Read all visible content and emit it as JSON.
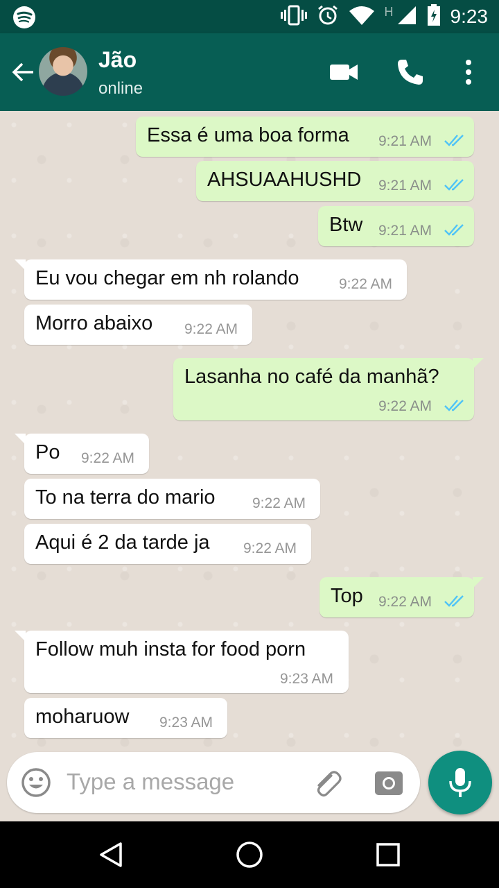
{
  "status_bar": {
    "time": "9:23",
    "network_label": "H",
    "icons": [
      "spotify-icon",
      "vibrate-icon",
      "alarm-icon",
      "wifi-icon",
      "signal-icon",
      "battery-icon"
    ]
  },
  "header": {
    "contact_name": "Jão",
    "contact_status": "online",
    "icons": [
      "back-arrow-icon",
      "avatar",
      "video-call-icon",
      "phone-call-icon",
      "more-vert-icon"
    ]
  },
  "messages": [
    {
      "dir": "out",
      "text": "Essa é uma boa forma",
      "time": "9:21 AM",
      "read": true
    },
    {
      "dir": "out",
      "text": "AHSUAAHUSHD",
      "time": "9:21 AM",
      "read": true
    },
    {
      "dir": "out",
      "text": "Btw",
      "time": "9:21 AM",
      "read": true
    },
    {
      "dir": "in",
      "text": "Eu vou chegar em nh rolando",
      "time": "9:22 AM"
    },
    {
      "dir": "in",
      "text": "Morro abaixo",
      "time": "9:22 AM"
    },
    {
      "dir": "out",
      "text": "Lasanha no café da manhã?",
      "time": "9:22 AM",
      "read": true
    },
    {
      "dir": "in",
      "text": "Po",
      "time": "9:22 AM"
    },
    {
      "dir": "in",
      "text": "To na terra do mario",
      "time": "9:22 AM"
    },
    {
      "dir": "in",
      "text": "Aqui é 2 da tarde ja",
      "time": "9:22 AM"
    },
    {
      "dir": "out",
      "text": "Top",
      "time": "9:22 AM",
      "read": true
    },
    {
      "dir": "in",
      "text": "Follow muh insta for food porn",
      "time": "9:23 AM"
    },
    {
      "dir": "in",
      "text": "moharuow",
      "time": "9:23 AM"
    }
  ],
  "composer": {
    "placeholder": "Type a message",
    "icons": [
      "emoji-icon",
      "attach-icon",
      "camera-icon",
      "mic-icon"
    ]
  },
  "colors": {
    "status_bar": "#054d44",
    "app_bar": "#075e54",
    "outgoing_bubble": "#dcf8c6",
    "incoming_bubble": "#ffffff",
    "read_ticks": "#4fc3f7",
    "mic_button": "#0f8f7f"
  },
  "nav_bar": {
    "icons": [
      "nav-back-icon",
      "nav-home-icon",
      "nav-recents-icon"
    ]
  }
}
